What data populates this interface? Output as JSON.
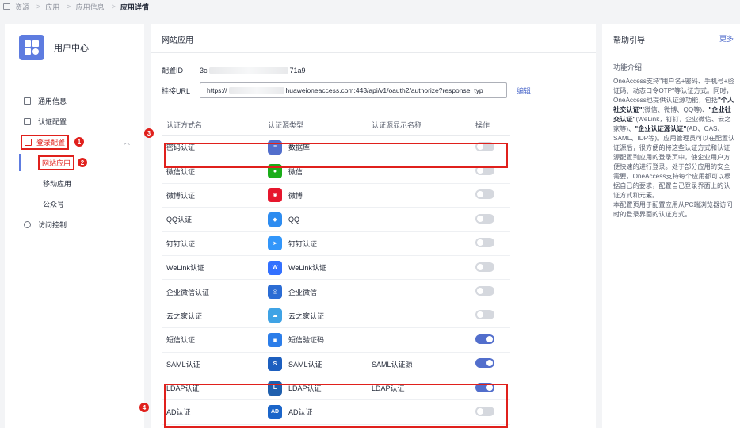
{
  "breadcrumb": {
    "items": [
      "资源",
      "应用",
      "应用信息"
    ],
    "current": "应用详情"
  },
  "app": {
    "name": "用户中心"
  },
  "nav": {
    "general": "通用信息",
    "auth_config": "认证配置",
    "login_config": "登录配置",
    "web_app": "网站应用",
    "mobile_app": "移动应用",
    "official_account": "公众号",
    "access_control": "访问控制"
  },
  "markers": {
    "m1": "1",
    "m2": "2",
    "m3": "3",
    "m4": "4"
  },
  "main": {
    "title": "网站应用",
    "config_id_label": "配置ID",
    "config_id_start": "3c",
    "config_id_end": "71a9",
    "url_label": "挂接URL",
    "url_start": "https://",
    "url_end": "huaweioneaccess.com:443/api/v1/oauth2/authorize?response_typ",
    "edit": "编辑"
  },
  "table": {
    "headers": [
      "认证方式名",
      "认证源类型",
      "认证源显示名称",
      "操作"
    ],
    "rows": [
      {
        "method": "密码认证",
        "icon": "database-icon",
        "icon_color": "#526ecc",
        "source": "数据库",
        "display": "",
        "enabled": false
      },
      {
        "method": "微信认证",
        "icon": "wechat-icon",
        "icon_color": "#1aad19",
        "source": "微信",
        "display": "",
        "enabled": false
      },
      {
        "method": "微博认证",
        "icon": "weibo-icon",
        "icon_color": "#e6162d",
        "source": "微博",
        "display": "",
        "enabled": false
      },
      {
        "method": "QQ认证",
        "icon": "qq-icon",
        "icon_color": "#2d8cf0",
        "source": "QQ",
        "display": "",
        "enabled": false
      },
      {
        "method": "钉钉认证",
        "icon": "dingtalk-icon",
        "icon_color": "#3296fa",
        "source": "钉钉认证",
        "display": "",
        "enabled": false
      },
      {
        "method": "WeLink认证",
        "icon": "welink-icon",
        "icon_color": "#3370ff",
        "source": "WeLink认证",
        "display": "",
        "enabled": false
      },
      {
        "method": "企业微信认证",
        "icon": "wecom-icon",
        "icon_color": "#2b6cd4",
        "source": "企业微信",
        "display": "",
        "enabled": false
      },
      {
        "method": "云之家认证",
        "icon": "yunzhijia-icon",
        "icon_color": "#3fa3e5",
        "source": "云之家认证",
        "display": "",
        "enabled": false
      },
      {
        "method": "短信认证",
        "icon": "sms-icon",
        "icon_color": "#2b7de9",
        "source": "短信验证码",
        "display": "",
        "enabled": true
      },
      {
        "method": "SAML认证",
        "icon": "saml-icon",
        "icon_color": "#1d5fbf",
        "source": "SAML认证",
        "display": "SAML认证源",
        "enabled": true
      },
      {
        "method": "LDAP认证",
        "icon": "ldap-icon",
        "icon_color": "#1f5fad",
        "source": "LDAP认证",
        "display": "LDAP认证",
        "enabled": true
      },
      {
        "method": "AD认证",
        "icon": "ad-icon",
        "icon_color": "#1b65c9",
        "source": "AD认证",
        "display": "",
        "enabled": false
      }
    ]
  },
  "help": {
    "title": "帮助引导",
    "more": "更多",
    "subtitle": "功能介绍",
    "p1": "OneAccess支持\"用户名+密码、手机号+验证码、动态口令OTP\"等认证方式。同时，OneAccess也提供认证源功能，包括",
    "b1": "\"个人社交认证\"",
    "p2": "(微信、微博、QQ等)、",
    "b2": "\"企业社交认证\"",
    "p3": "(WeLink，钉钉，企业微信、云之家等)、",
    "b3": "\"企业认证源认证\"",
    "p4": "(AD、CAS、SAML、IDP等)。应用管理员可以在配置认证源后，很方便的将这些认证方式和认证源配置到应用的登录页中，使企业用户方便快速的进行登录。处于部分应用的安全需要，OneAccess支持每个应用都可以根据自己的要求，配置自己登录界面上的认证方式和元素。",
    "p5": "本配置页用于配置应用从PC端浏览器访问时的登录界面的认证方式。"
  }
}
